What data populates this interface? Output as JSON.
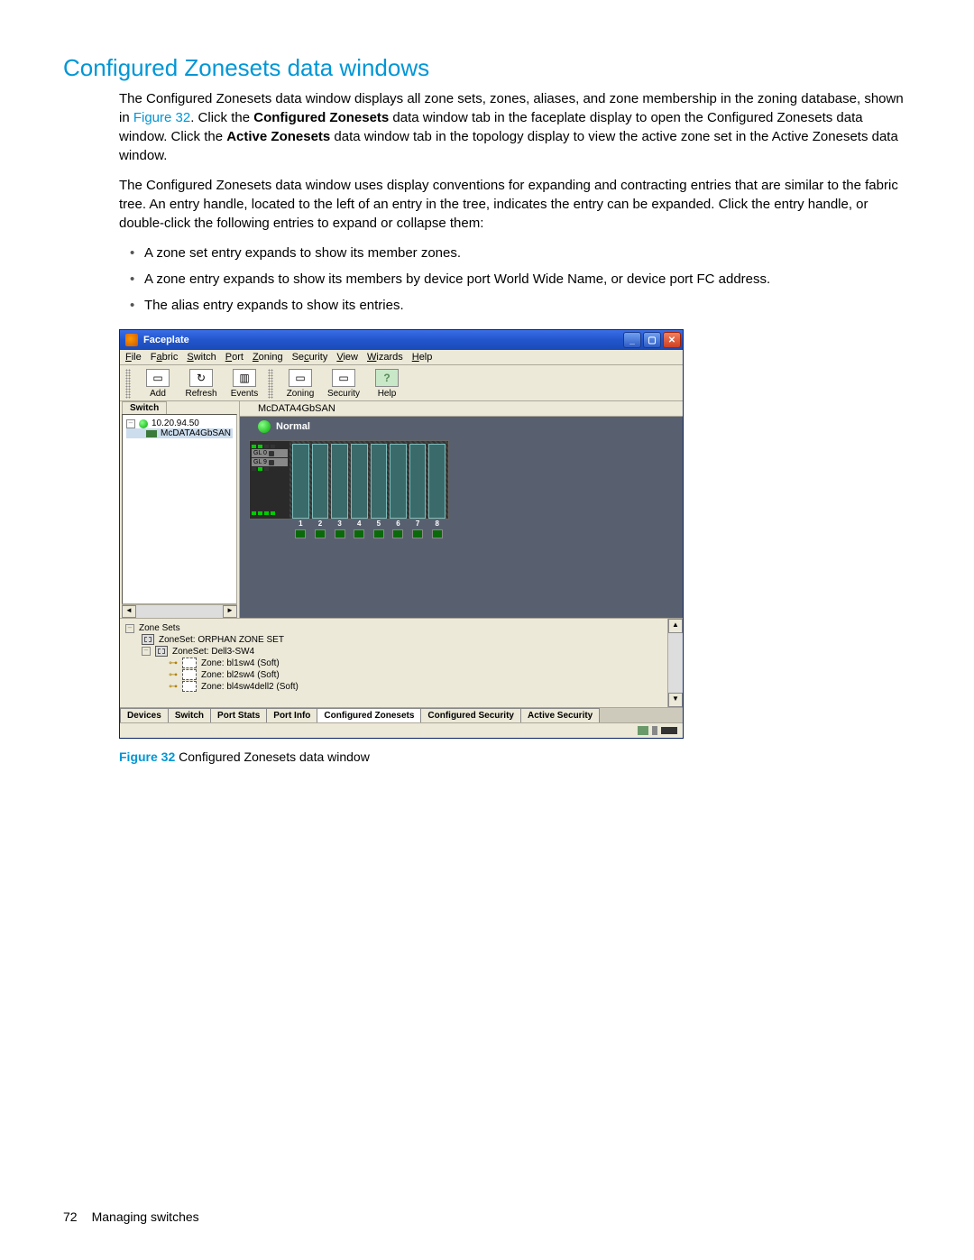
{
  "section_title": "Configured Zonesets data windows",
  "para1_a": "The Configured Zonesets data window displays all zone sets, zones, aliases, and zone membership in the zoning database, shown in ",
  "para1_link": "Figure 32",
  "para1_b": ". Click the ",
  "para1_bold1": "Configured Zonesets",
  "para1_c": " data window tab in the faceplate display to open the Configured Zonesets data window. Click the ",
  "para1_bold2": "Active Zonesets",
  "para1_d": " data window tab in the topology display to view the active zone set in the Active Zonesets data window.",
  "para2": "The Configured Zonesets data window uses display conventions for expanding and contracting entries that are similar to the fabric tree. An entry handle, located to the left of an entry in the tree, indicates the entry can be expanded. Click the entry handle, or double-click the following entries to expand or collapse them:",
  "bullets": [
    "A zone set entry expands to show its member zones.",
    "A zone entry expands to show its members by device port World Wide Name, or device port FC address.",
    "The alias entry expands to show its entries."
  ],
  "app": {
    "title": "Faceplate",
    "menus": [
      "File",
      "Fabric",
      "Switch",
      "Port",
      "Zoning",
      "Security",
      "View",
      "Wizards",
      "Help"
    ],
    "toolbar": [
      {
        "label": "Add",
        "icon": "▭"
      },
      {
        "label": "Refresh",
        "icon": "↻"
      },
      {
        "label": "Events",
        "icon": "▥"
      },
      {
        "label": "Zoning",
        "icon": "▭"
      },
      {
        "label": "Security",
        "icon": "▭"
      },
      {
        "label": "Help",
        "icon": "?"
      }
    ],
    "left_tab": "Switch",
    "fabric_ip": "10.20.94.50",
    "fabric_switch": "McDATA4GbSAN",
    "right_header": "McDATA4GbSAN",
    "status": "Normal",
    "port_labels": [
      "1",
      "2",
      "3",
      "4",
      "5",
      "6",
      "7",
      "8"
    ],
    "gl_labels": [
      "GL 0",
      "GL 9"
    ],
    "zonesets_root": "Zone Sets",
    "zoneset1": "ZoneSet: ORPHAN ZONE SET",
    "zoneset2": "ZoneSet: Dell3-SW4",
    "zone1": "Zone: bl1sw4 (Soft)",
    "zone2": "Zone: bl2sw4 (Soft)",
    "zone3": "Zone: bl4sw4dell2 (Soft)",
    "bottom_tabs": [
      "Devices",
      "Switch",
      "Port Stats",
      "Port Info",
      "Configured Zonesets",
      "Configured Security",
      "Active Security"
    ],
    "active_bottom_tab": 4
  },
  "caption_fig": "Figure 32",
  "caption_text": " Configured Zonesets data window",
  "footer_page": "72",
  "footer_text": "Managing switches"
}
